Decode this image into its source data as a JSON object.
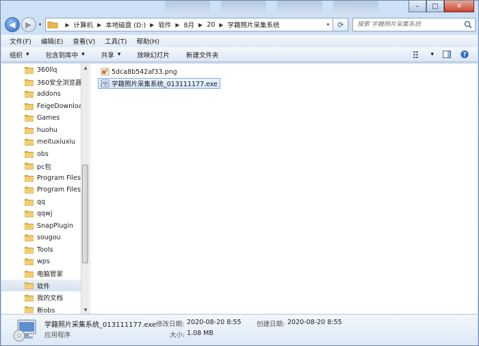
{
  "window": {
    "close_glyph": "✕",
    "max_glyph": "□",
    "min_glyph": "–"
  },
  "nav": {
    "back_glyph": "◀",
    "forward_glyph": "▶",
    "dropdown_glyph": "▾"
  },
  "address": {
    "sep_glyph": "▶",
    "crumbs": [
      "计算机",
      "本地磁盘 (D:)",
      "软件",
      "8月",
      "20",
      "学籍照片采集系统"
    ],
    "end_glyph": "▾",
    "refresh_glyph": "⟳"
  },
  "search": {
    "placeholder": "搜索 学籍照片采集系统"
  },
  "menu": [
    "文件(F)",
    "编辑(E)",
    "查看(V)",
    "工具(T)",
    "帮助(H)"
  ],
  "commands": {
    "organize": "组织",
    "include_library": "包含到库中",
    "share": "共享",
    "slideshow": "放映幻灯片",
    "new_folder": "新建文件夹",
    "dropdown_glyph": "▼"
  },
  "tree": {
    "items": [
      "360llq",
      "360安全浏览器",
      "addons",
      "FeigeDownloa",
      "Games",
      "huohu",
      "meituxiuxiu",
      "obs",
      "pc包",
      "Program Files",
      "Program Files",
      "qq",
      "qqwj",
      "SnapPlugin",
      "sougou",
      "Tools",
      "wps",
      "电脑管家",
      "软件",
      "我的文档",
      "新obs"
    ],
    "selected_index": 18,
    "scroll_up_glyph": "▲",
    "scroll_down_glyph": "▼"
  },
  "files": [
    {
      "name": "5dca8b542af33.png",
      "type": "png",
      "selected": false
    },
    {
      "name": "学籍照片采集系统_013111177.exe",
      "type": "exe",
      "selected": true
    }
  ],
  "details": {
    "name": "学籍照片采集系统_013111177.exe",
    "type": "应用程序",
    "modified_label": "修改日期:",
    "modified_value": "2020-08-20 8:55",
    "created_label": "创建日期:",
    "created_value": "2020-08-20 8:55",
    "size_label": "大小:",
    "size_value": "1.08 MB"
  },
  "colors": {
    "folder": "#e8b84a",
    "selection_border": "#84acdd",
    "accent_blue": "#2a66b8"
  }
}
